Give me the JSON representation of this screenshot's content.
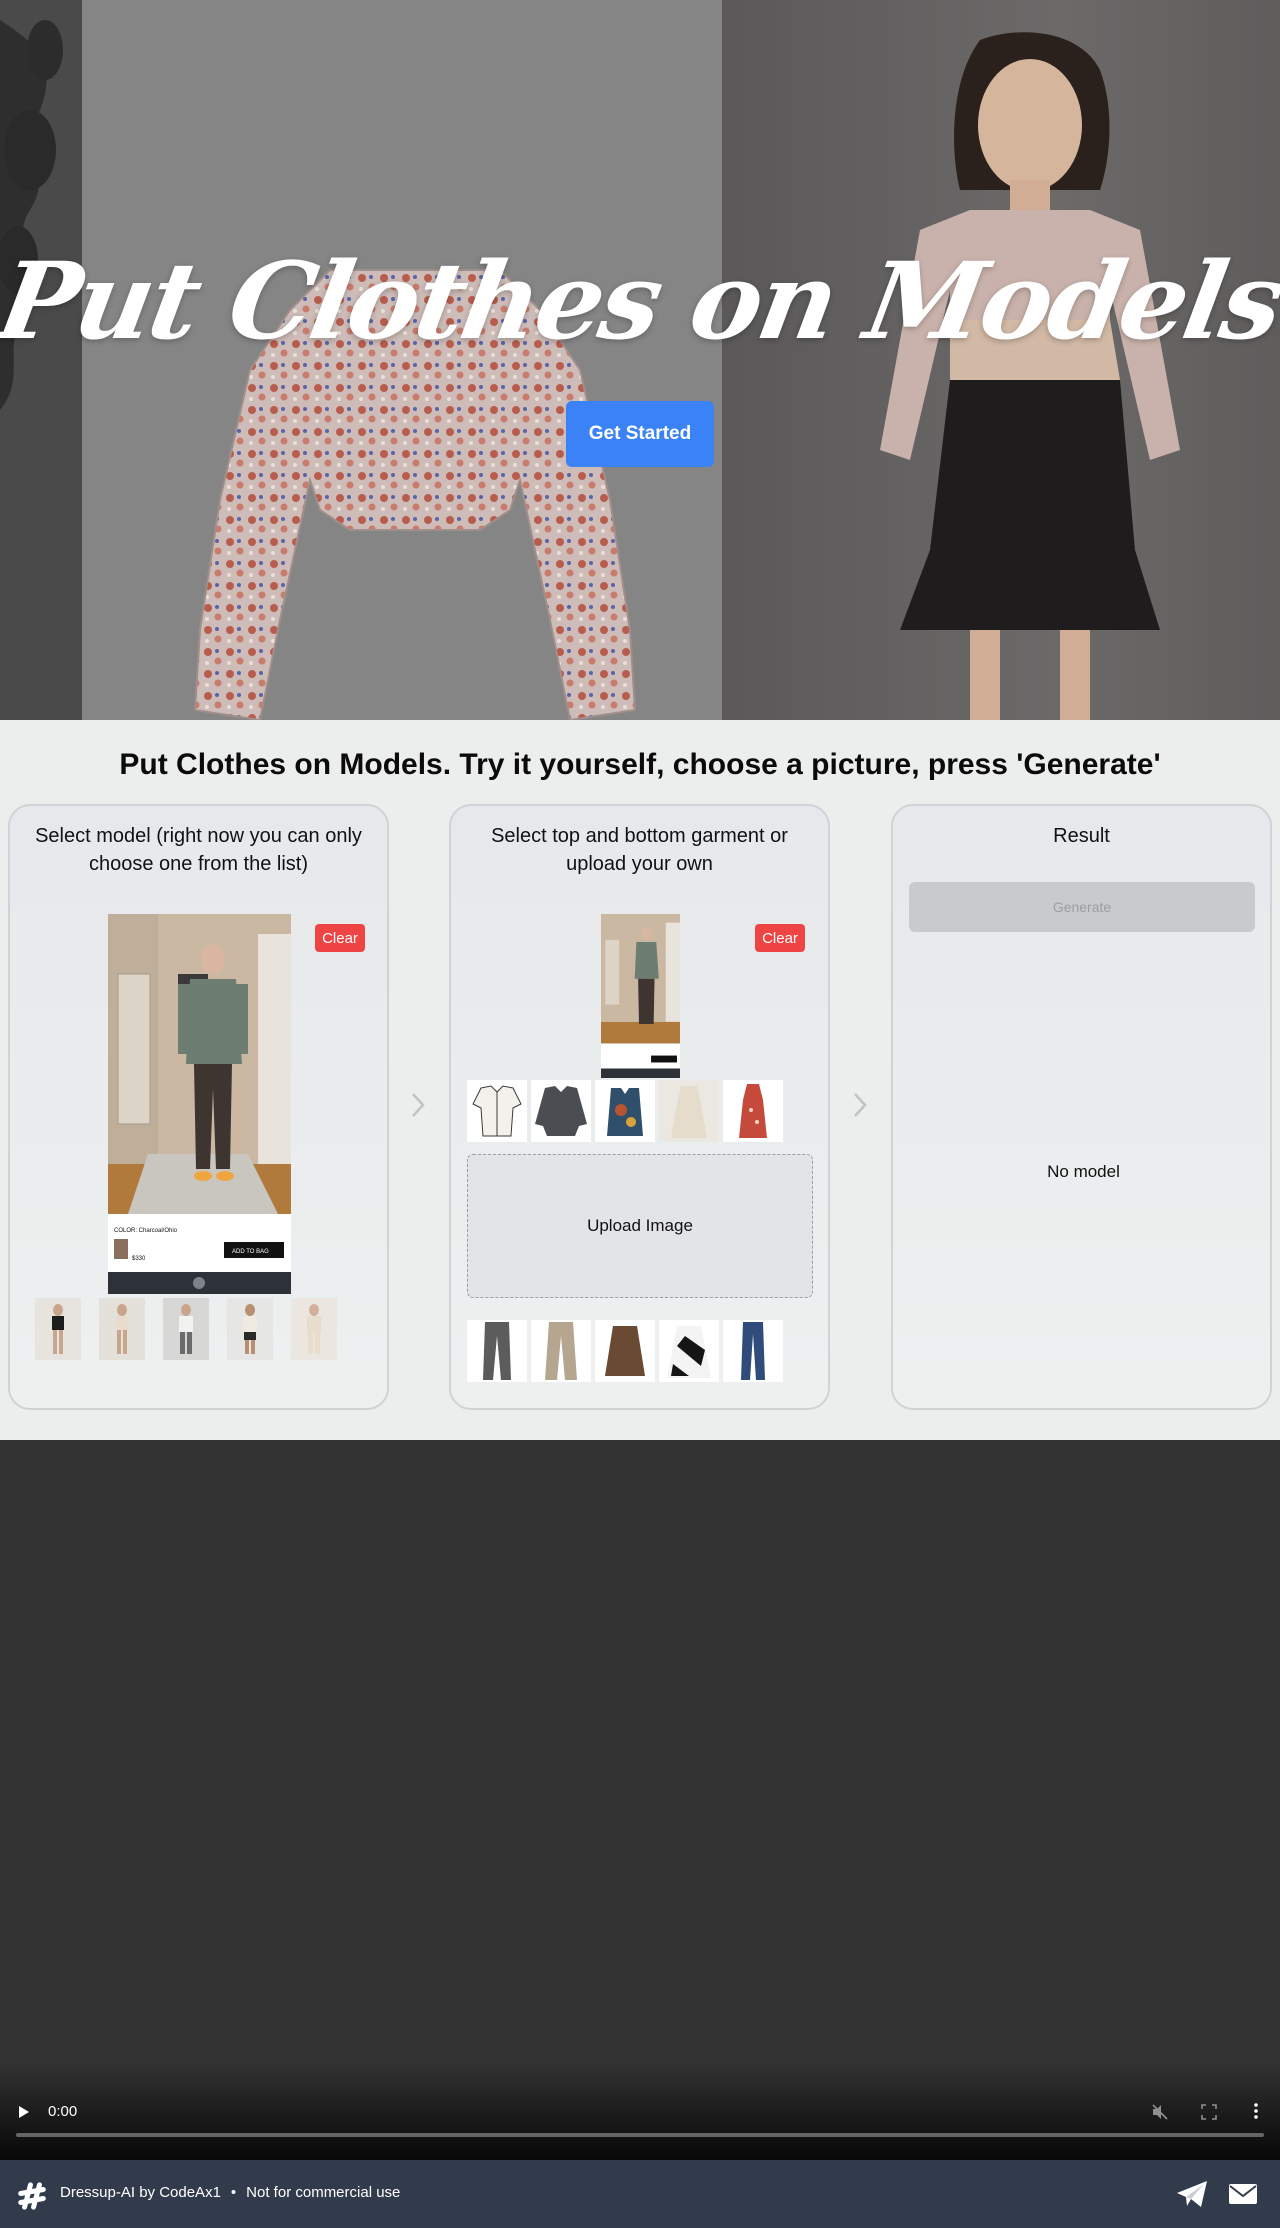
{
  "hero": {
    "title": "Put Clothes on Models",
    "cta_label": "Get Started"
  },
  "demo": {
    "heading": "Put Clothes on Models. Try it yourself, choose a picture, press 'Generate'",
    "model_card": {
      "title": "Select model (right now you can only choose one from the list)",
      "clear_label": "Clear",
      "phone_ui": {
        "color_text": "COLOR: Charcoal/Ohio",
        "add_to_bag": "ADD TO BAG",
        "price": "$330"
      }
    },
    "garment_card": {
      "title": "Select top and bottom garment or upload your own",
      "clear_label": "Clear",
      "upload_label": "Upload Image"
    },
    "result_card": {
      "title": "Result",
      "generate_label": "Generate",
      "empty_text": "No model"
    }
  },
  "video": {
    "time": "0:00"
  },
  "footer": {
    "brand": "Dressup-AI by CodeAx1",
    "separator": "•",
    "notice": "Not for commercial use"
  },
  "colors": {
    "accent": "#3b82f6",
    "danger": "#ef4444",
    "footer_bg": "#323b4c",
    "video_bg": "#333333"
  }
}
